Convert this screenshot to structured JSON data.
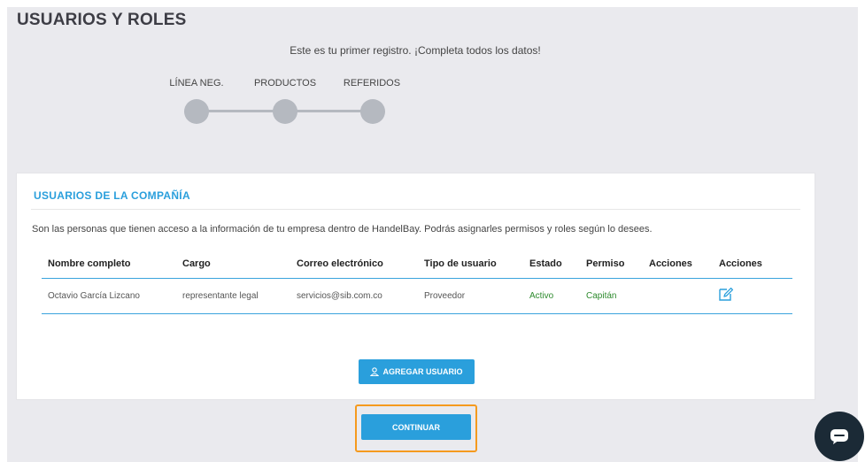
{
  "page": {
    "title": "USUARIOS Y ROLES",
    "first_record_message": "Este es tu primer registro. ¡Completa todos los datos!"
  },
  "steps": [
    {
      "label": "LÍNEA NEG."
    },
    {
      "label": "PRODUCTOS"
    },
    {
      "label": "REFERIDOS"
    }
  ],
  "users_card": {
    "title": "USUARIOS DE LA COMPAÑÍA",
    "description": "Son las personas que tienen acceso a la información de tu empresa dentro de HandelBay. Podrás asignarles permisos y roles según lo desees.",
    "columns": [
      "Nombre completo",
      "Cargo",
      "Correo electrónico",
      "Tipo de usuario",
      "Estado",
      "Permiso",
      "Acciones",
      "Acciones"
    ],
    "rows": [
      {
        "name": "Octavio García Lizcano",
        "position": "representante legal",
        "email": "servicios@sib.com.co",
        "user_type": "Proveedor",
        "status": "Activo",
        "permission": "Capitán",
        "actions": "",
        "edit_icon": "edit-icon"
      }
    ],
    "add_user_label": "AGREGAR USUARIO"
  },
  "continue_label": "CONTINUAR",
  "colors": {
    "accent": "#2a9fdc",
    "status_green": "#2e8b2e",
    "highlight_orange": "#f59a1e",
    "step_gray": "#b5b9c0",
    "chat_dark": "#1b2a36"
  }
}
